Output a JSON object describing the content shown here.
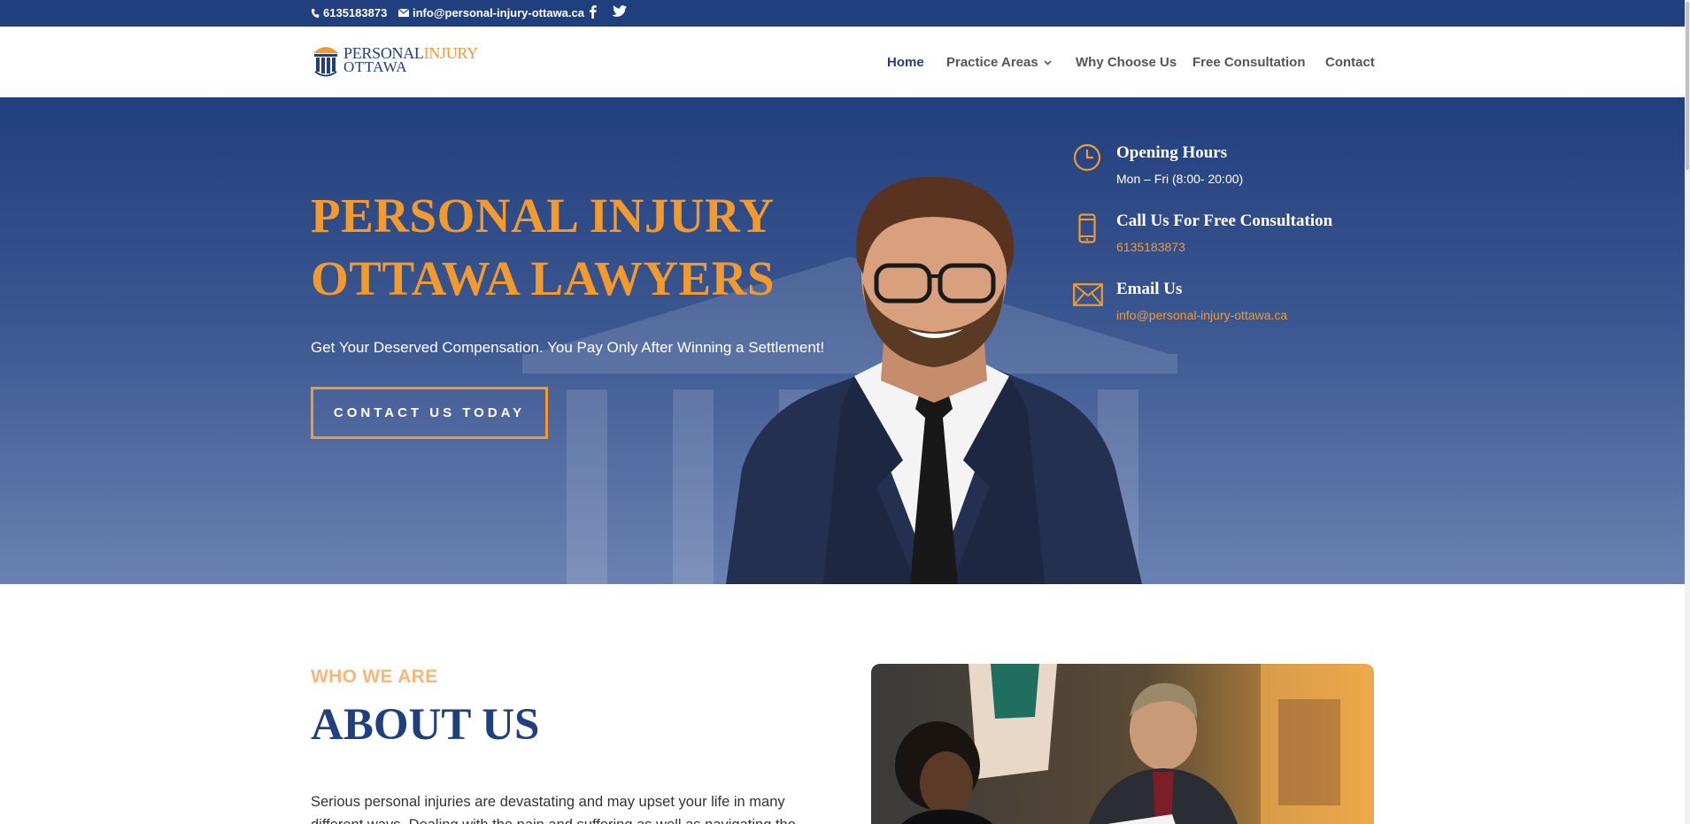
{
  "topbar": {
    "phone": "6135183873",
    "email": "info@personal-injury-ottawa.ca",
    "social": [
      "facebook-icon",
      "twitter-icon"
    ]
  },
  "header": {
    "logo": {
      "word1": "PERSONAL",
      "word2": "INJURY",
      "word3": "OTTAWA"
    },
    "nav": [
      {
        "label": "Home",
        "active": true
      },
      {
        "label": "Practice Areas",
        "has_dropdown": true
      },
      {
        "label": "Why Choose Us"
      },
      {
        "label": "Free Consultation"
      },
      {
        "label": "Contact"
      }
    ]
  },
  "hero": {
    "title_line1": "PERSONAL INJURY",
    "title_line2": "OTTAWA LAWYERS",
    "subtitle": "Get Your Deserved Compensation. You Pay Only After Winning a Settlement!",
    "cta_label": "CONTACT US TODAY",
    "info": [
      {
        "icon": "clock-icon",
        "title": "Opening Hours",
        "value": "Mon – Fri (8:00- 20:00)"
      },
      {
        "icon": "phone-icon",
        "title": "Call Us For Free Consultation",
        "value": "6135183873"
      },
      {
        "icon": "envelope-icon",
        "title": "Email Us",
        "value": "info@personal-injury-ottawa.ca"
      }
    ]
  },
  "about": {
    "kicker": "WHO WE ARE",
    "title": "ABOUT US",
    "text": "Serious personal injuries are devastating and may upset your life in many different ways. Dealing with the pain and suffering as well as navigating the"
  },
  "colors": {
    "navy": "#203f7f",
    "orange": "#f29a2e",
    "light_orange": "#f7b77a"
  }
}
